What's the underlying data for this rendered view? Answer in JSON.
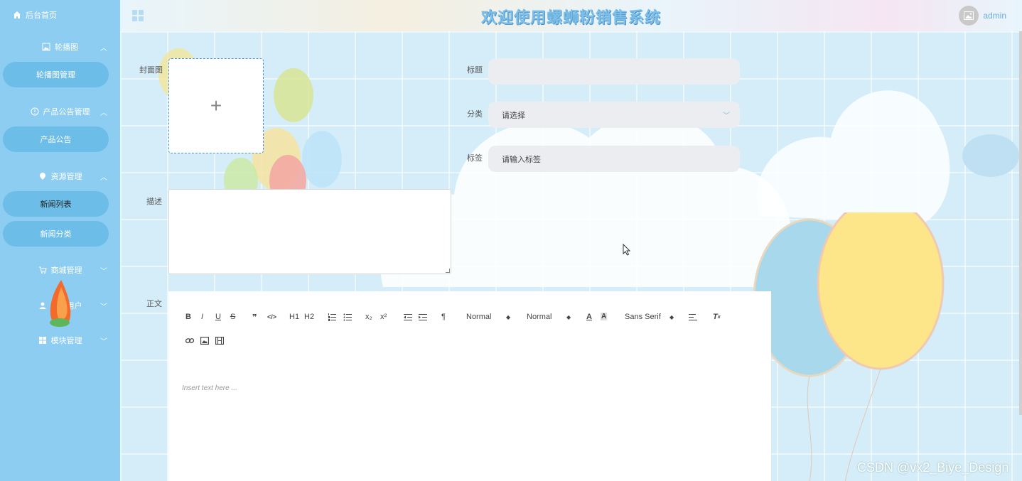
{
  "header": {
    "title": "欢迎使用螺蛳粉销售系统",
    "user": "admin"
  },
  "sidebar": {
    "home": "后台首页",
    "groups": [
      {
        "label": "轮播图",
        "items": [
          "轮播图管理"
        ]
      },
      {
        "label": "产品公告管理",
        "items": [
          "产品公告"
        ]
      },
      {
        "label": "资源管理",
        "items": [
          "新闻列表",
          "新闻分类"
        ]
      },
      {
        "label": "商城管理",
        "items": []
      },
      {
        "label": "系统用户",
        "items": []
      },
      {
        "label": "模块管理",
        "items": []
      }
    ]
  },
  "form": {
    "cover_label": "封面图",
    "title_label": "标题",
    "title_value": "",
    "category_label": "分类",
    "category_placeholder": "请选择",
    "tag_label": "标签",
    "tag_placeholder": "请输入标签",
    "desc_label": "描述",
    "body_label": "正文"
  },
  "editor": {
    "toolbar_row1": [
      "B",
      "I",
      "U",
      "S",
      "❞",
      "</>",
      "H1",
      "H2",
      "ol",
      "ul",
      "x₂",
      "x²",
      "outdent",
      "indent",
      "¶"
    ],
    "size_select": "Normal",
    "header_select": "Normal",
    "font_select": "Sans Serif",
    "placeholder": "Insert text here ..."
  },
  "watermark": "CSDN @vx2_Biye_Design",
  "colors": {
    "sidebar": "#8ecdf2",
    "sidebar_item": "#6dbde9",
    "title": "#7cc0ea",
    "field": "#ecedf0"
  }
}
